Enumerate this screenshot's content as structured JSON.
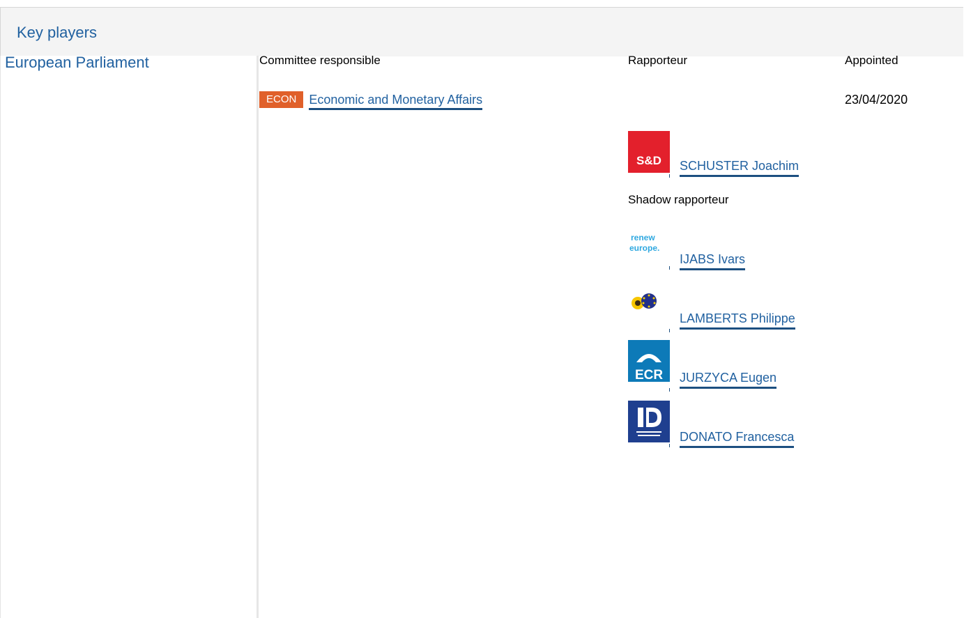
{
  "panel": {
    "title": "Key players"
  },
  "institution": "European Parliament",
  "headers": {
    "committee": "Committee responsible",
    "rapporteur": "Rapporteur",
    "appointed": "Appointed"
  },
  "committee": {
    "code": "ECON",
    "name": "Economic and Monetary Affairs",
    "appointed_date": "23/04/2020",
    "badge_color": "#e0602a"
  },
  "rapporteur": {
    "name": "SCHUSTER Joachim",
    "group_logo": "S&D"
  },
  "shadow_label": "Shadow rapporteur",
  "shadow_rapporteurs": [
    {
      "name": "IJABS Ivars",
      "group_logo": "renew europe."
    },
    {
      "name": "LAMBERTS Philippe",
      "group_logo": "greens-efa-icon"
    },
    {
      "name": "JURZYCA Eugen",
      "group_logo": "ECR"
    },
    {
      "name": "DONATO Francesca",
      "group_logo": "id-icon"
    }
  ],
  "colors": {
    "link": "#2161a0",
    "link_underline": "#1c4f80",
    "header_bg": "#f4f4f4"
  }
}
